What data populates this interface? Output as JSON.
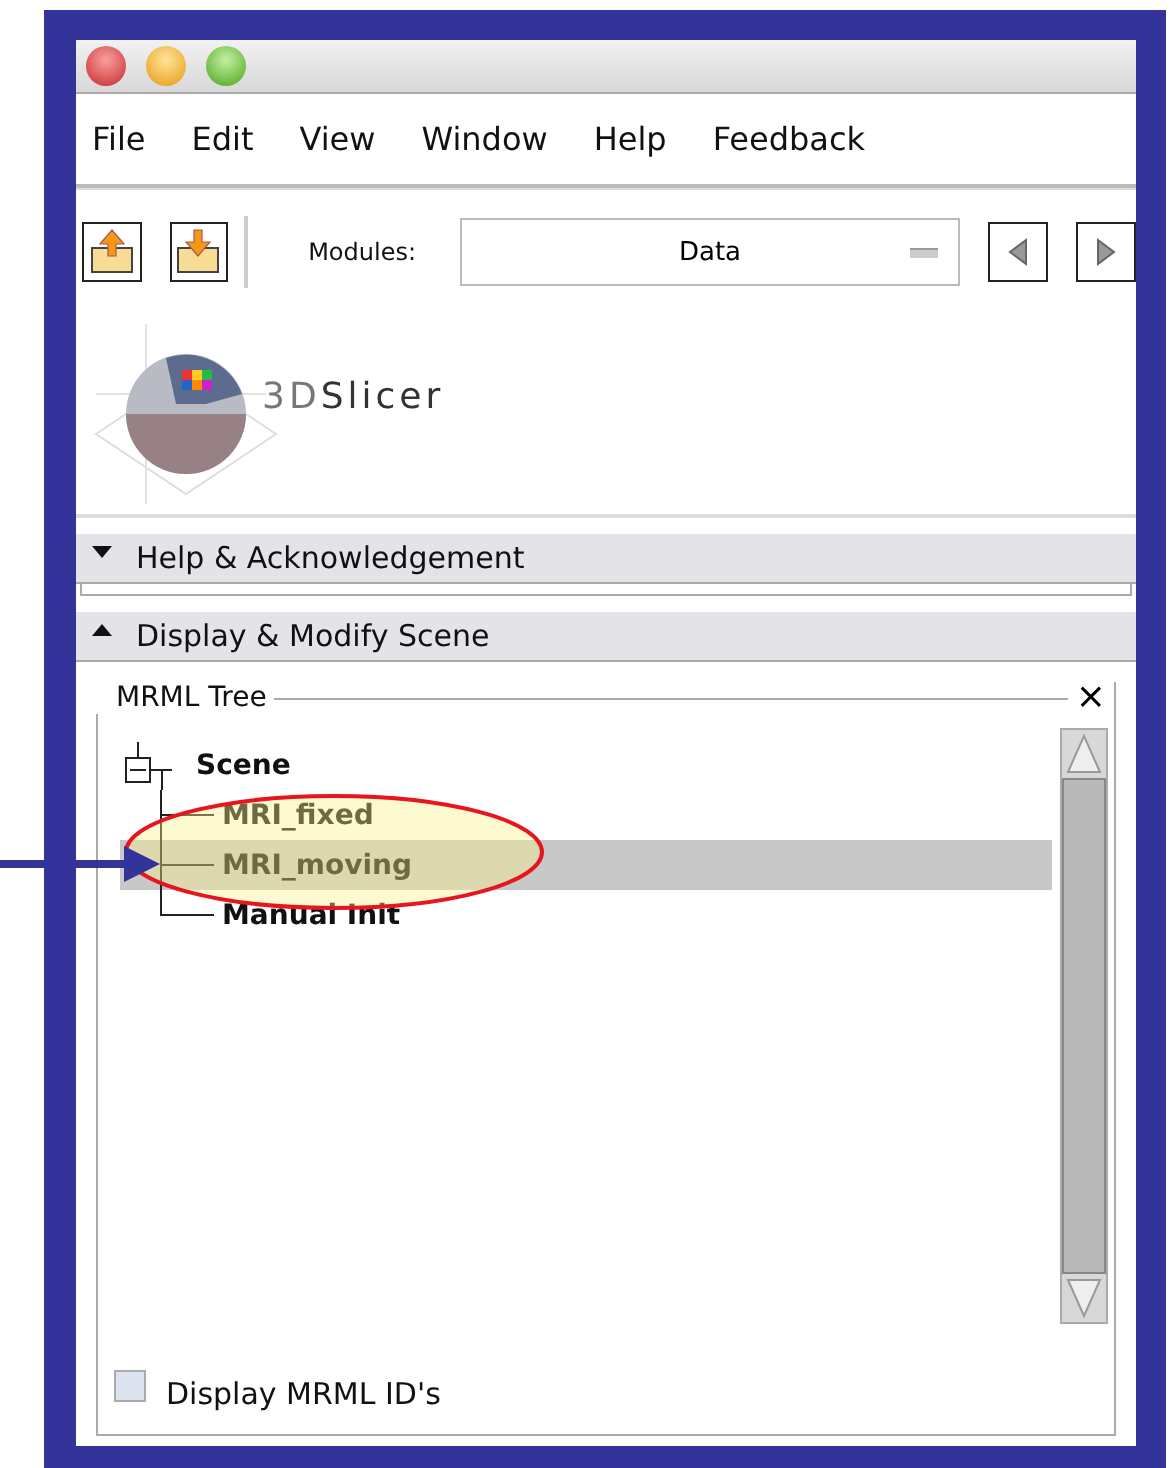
{
  "menu": [
    "File",
    "Edit",
    "View",
    "Window",
    "Help",
    "Feedback"
  ],
  "toolbar": {
    "modules_label": "Modules:",
    "modules_value": "Data"
  },
  "logo": {
    "prefix": "3D",
    "name": "Slicer"
  },
  "sections": [
    {
      "title": "Help & Acknowledgement",
      "expanded": false
    },
    {
      "title": "Display & Modify Scene",
      "expanded": true
    }
  ],
  "mrml_tree": {
    "title": "MRML Tree",
    "close": "×",
    "nodes": [
      {
        "label": "Scene",
        "expanded": true,
        "selected": false,
        "children": [
          {
            "label": "MRI_fixed",
            "selected": false
          },
          {
            "label": "MRI_moving",
            "selected": true
          },
          {
            "label": "Manual Init",
            "selected": false
          }
        ]
      }
    ],
    "display_ids": {
      "label": "Display MRML ID's",
      "checked": false
    }
  }
}
